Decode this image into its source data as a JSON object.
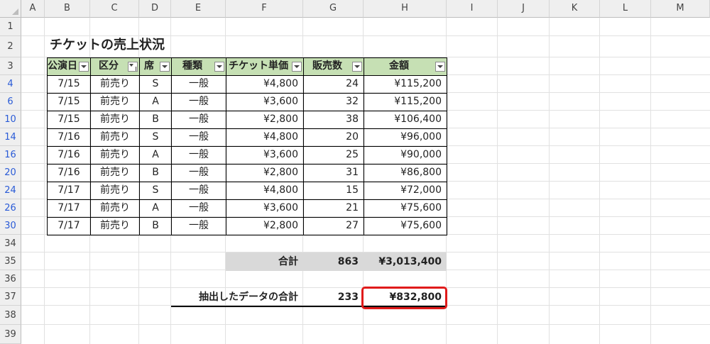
{
  "columns": [
    "A",
    "B",
    "C",
    "D",
    "E",
    "F",
    "G",
    "H",
    "I",
    "J",
    "K",
    "L",
    "M"
  ],
  "rows": [
    "1",
    "2",
    "3",
    "4",
    "6",
    "10",
    "14",
    "16",
    "20",
    "24",
    "26",
    "30",
    "34",
    "35",
    "36",
    "37",
    "38",
    "39"
  ],
  "sheet_title": "チケットの売上状況",
  "headers": [
    "公演日",
    "区分",
    "席",
    "種類",
    "チケット単価",
    "販売数",
    "金額"
  ],
  "data_rows": [
    [
      "7/15",
      "前売り",
      "S",
      "一般",
      "¥4,800",
      "24",
      "¥115,200"
    ],
    [
      "7/15",
      "前売り",
      "A",
      "一般",
      "¥3,600",
      "32",
      "¥115,200"
    ],
    [
      "7/15",
      "前売り",
      "B",
      "一般",
      "¥2,800",
      "38",
      "¥106,400"
    ],
    [
      "7/16",
      "前売り",
      "S",
      "一般",
      "¥4,800",
      "20",
      "¥96,000"
    ],
    [
      "7/16",
      "前売り",
      "A",
      "一般",
      "¥3,600",
      "25",
      "¥90,000"
    ],
    [
      "7/16",
      "前売り",
      "B",
      "一般",
      "¥2,800",
      "31",
      "¥86,800"
    ],
    [
      "7/17",
      "前売り",
      "S",
      "一般",
      "¥4,800",
      "15",
      "¥72,000"
    ],
    [
      "7/17",
      "前売り",
      "A",
      "一般",
      "¥3,600",
      "21",
      "¥75,600"
    ],
    [
      "7/17",
      "前売り",
      "B",
      "一般",
      "¥2,800",
      "27",
      "¥75,600"
    ]
  ],
  "total": {
    "label": "合計",
    "count": "863",
    "amount": "¥3,013,400"
  },
  "filtered_total": {
    "label": "抽出したデータの合計",
    "count": "233",
    "amount": "¥832,800"
  },
  "colors": {
    "header_fill": "#c6e0b4",
    "total_fill": "#d9d9d9",
    "highlight": "#e01b1b"
  }
}
